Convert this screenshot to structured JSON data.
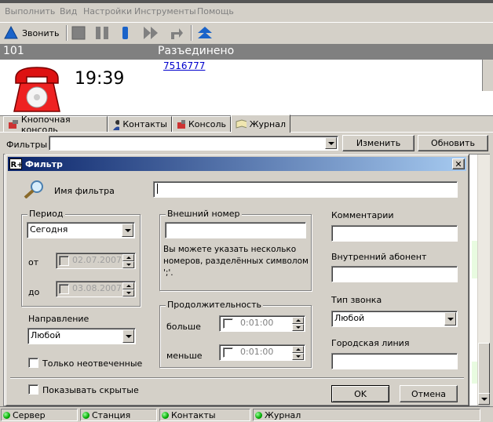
{
  "menu": [
    "Выполнить",
    "Вид",
    "Настройки",
    "Инструменты",
    "Помощь"
  ],
  "toolbar": {
    "call_label": "Звонить"
  },
  "call": {
    "line": "101",
    "status": "Разъединено",
    "time": "19:39",
    "number": "7516777"
  },
  "tabs": [
    "Кнопочная консоль",
    "Контакты",
    "Консоль",
    "Журнал"
  ],
  "filters": {
    "label": "Фильтры",
    "value": "",
    "edit_button": "Изменить",
    "refresh_button": "Обновить"
  },
  "dialog": {
    "title": "Фильтр",
    "filter_name_label": "Имя фильтра",
    "filter_name_value": "",
    "period": {
      "legend": "Период",
      "value": "Сегодня",
      "from_label": "от",
      "from_date": "02.07.2007",
      "to_label": "до",
      "to_date": "03.08.2007"
    },
    "direction": {
      "label": "Направление",
      "value": "Любой"
    },
    "unanswered_label": "Только неотвеченные",
    "external": {
      "legend": "Внешний номер",
      "value": "",
      "hint": "Вы можете указать несколько номеров, разделённых символом ';'."
    },
    "duration": {
      "legend": "Продолжительность",
      "more_label": "больше",
      "more_value": "0:01:00",
      "less_label": "меньше",
      "less_value": "0:01:00"
    },
    "comments_label": "Комментарии",
    "internal_label": "Внутренний абонент",
    "call_type": {
      "label": "Тип звонка",
      "value": "Любой"
    },
    "city_line_label": "Городская линия",
    "show_hidden_label": "Показывать скрытые",
    "ok_button": "OK",
    "cancel_button": "Отмена"
  },
  "status": [
    "Сервер",
    "Станция",
    "Контакты",
    "Журнал"
  ],
  "colors": {
    "led": "#00aa00",
    "title_start": "#0a246a",
    "title_end": "#a6caf0"
  }
}
